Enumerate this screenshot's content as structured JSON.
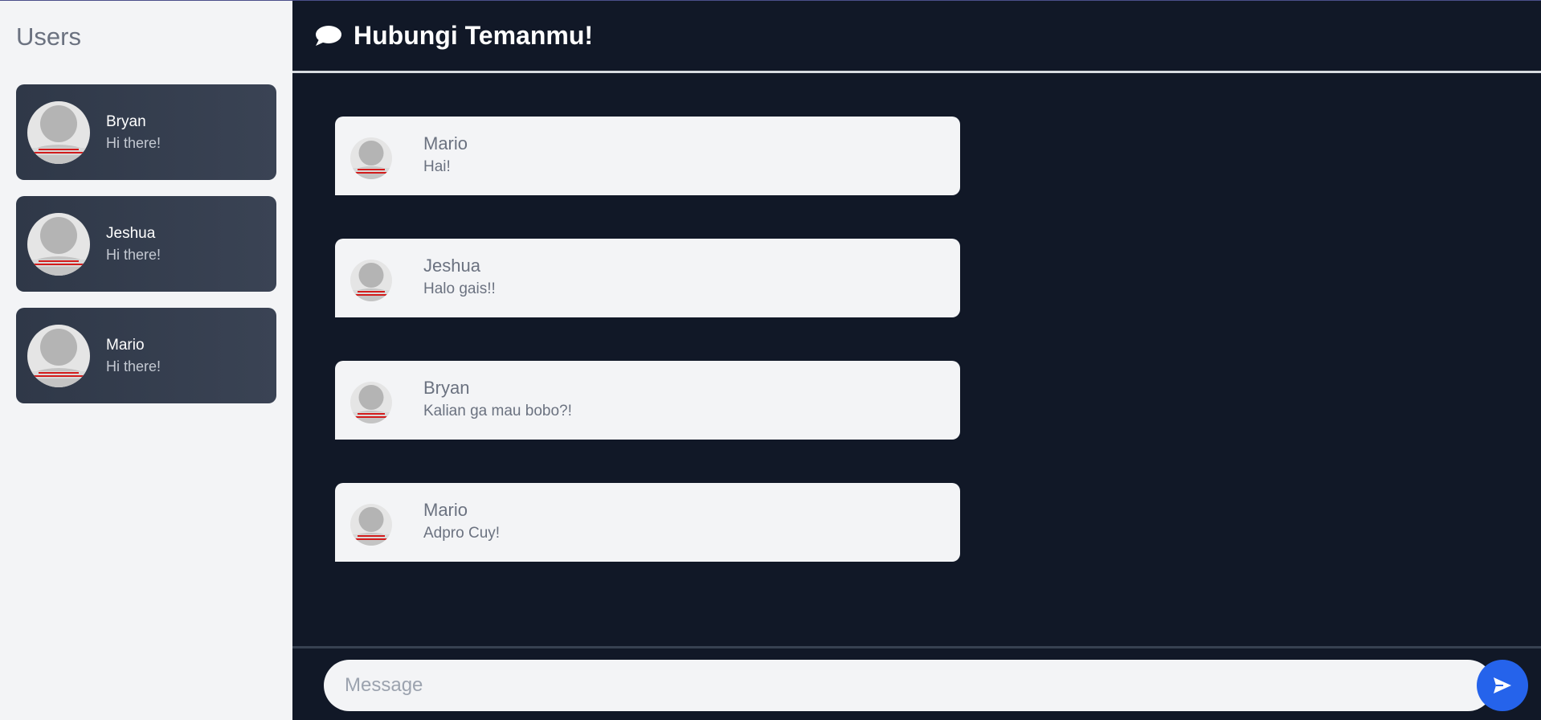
{
  "sidebar": {
    "title": "Users",
    "users": [
      {
        "name": "Bryan",
        "last_message": "Hi there!"
      },
      {
        "name": "Jeshua",
        "last_message": "Hi there!"
      },
      {
        "name": "Mario",
        "last_message": "Hi there!"
      }
    ]
  },
  "header": {
    "icon": "chat-bubble-icon",
    "title": "Hubungi Temanmu!"
  },
  "messages": [
    {
      "sender": "Mario",
      "text": "Hai!"
    },
    {
      "sender": "Jeshua",
      "text": "Halo gais!!"
    },
    {
      "sender": "Bryan",
      "text": "Kalian ga mau bobo?!"
    },
    {
      "sender": "Mario",
      "text": "Adpro Cuy!"
    }
  ],
  "composer": {
    "placeholder": "Message",
    "value": "",
    "send_icon": "send-icon"
  },
  "colors": {
    "sidebar_bg": "#f3f4f6",
    "card_bg": "#343d4e",
    "main_bg": "#111827",
    "bubble_bg": "#f3f4f6",
    "send_button": "#2563eb"
  }
}
